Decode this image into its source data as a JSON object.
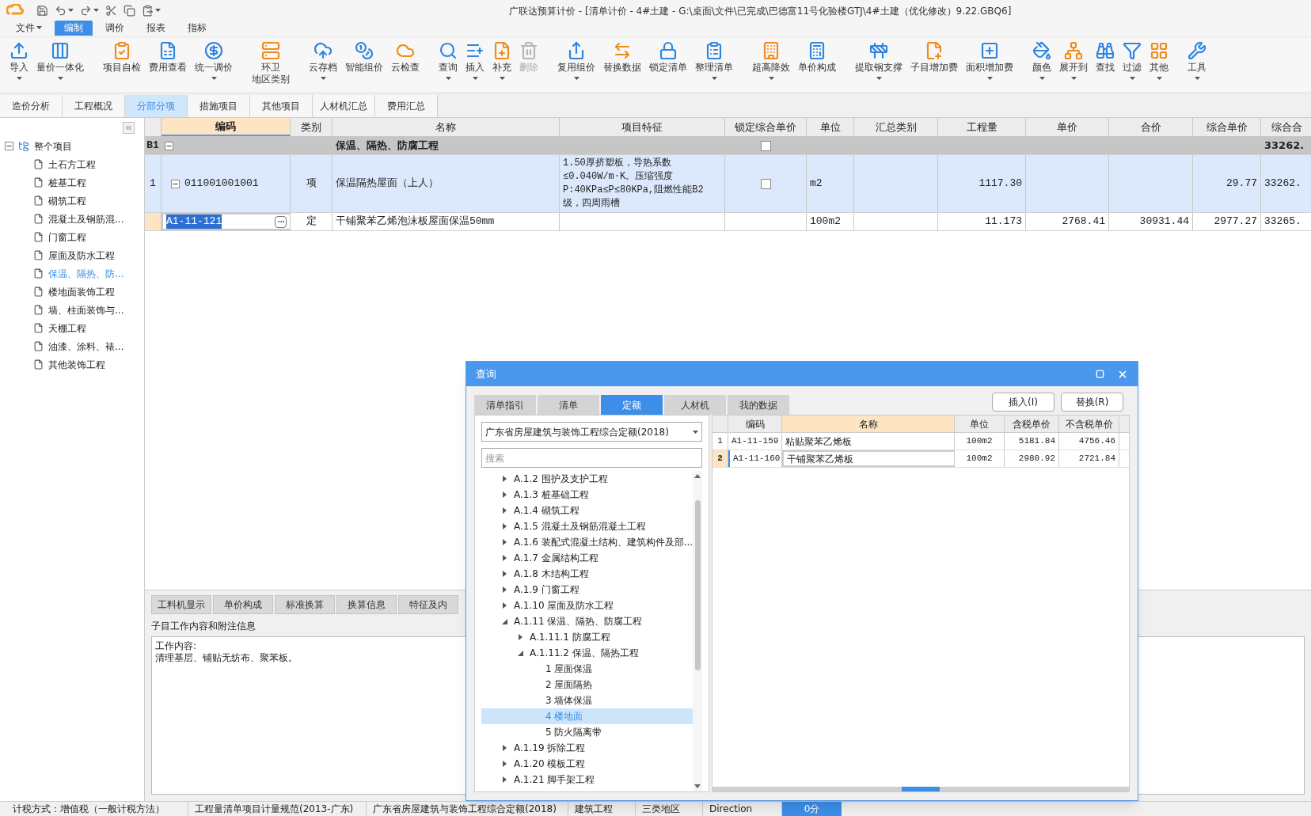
{
  "title_bar": {
    "title": "广联达预算计价 - [清单计价 - 4#土建 - G:\\桌面\\文件\\已完成\\巴德富11号化验楼GTJ\\4#土建（优化修改）9.22.GBQ6]"
  },
  "menu": [
    {
      "label": "文件",
      "dropdown": true,
      "selected": false
    },
    {
      "label": "编制",
      "dropdown": false,
      "selected": true
    },
    {
      "label": "调价",
      "dropdown": false,
      "selected": false
    },
    {
      "label": "报表",
      "dropdown": false,
      "selected": false
    },
    {
      "label": "指标",
      "dropdown": false,
      "selected": false
    }
  ],
  "ribbon": [
    [
      {
        "label": "导入",
        "dropdown": true,
        "disabled": false
      },
      {
        "label": "量价一体化",
        "dropdown": true,
        "disabled": false
      }
    ],
    [
      {
        "label": "项目自检",
        "dropdown": false,
        "disabled": false
      },
      {
        "label": "费用查看",
        "dropdown": false,
        "disabled": false
      },
      {
        "label": "统一调价",
        "dropdown": true,
        "disabled": false
      }
    ],
    [
      {
        "lines": [
          "环卫",
          "地区类别"
        ],
        "dropdown": false,
        "disabled": false
      }
    ],
    [
      {
        "label": "云存档",
        "dropdown": true,
        "disabled": false
      },
      {
        "label": "智能组价",
        "dropdown": false,
        "disabled": false
      },
      {
        "label": "云检查",
        "dropdown": false,
        "disabled": false
      }
    ],
    [
      {
        "label": "查询",
        "dropdown": true,
        "disabled": false
      },
      {
        "label": "插入",
        "dropdown": true,
        "disabled": false
      },
      {
        "label": "补充",
        "dropdown": true,
        "disabled": false
      },
      {
        "label": "删除",
        "dropdown": false,
        "disabled": true
      }
    ],
    [
      {
        "label": "复用组价",
        "dropdown": true,
        "disabled": false
      },
      {
        "label": "替换数据",
        "dropdown": false,
        "disabled": false
      },
      {
        "label": "锁定清单",
        "dropdown": false,
        "disabled": false
      },
      {
        "label": "整理清单",
        "dropdown": true,
        "disabled": false
      }
    ],
    [
      {
        "label": "超高降效",
        "dropdown": true,
        "disabled": false
      },
      {
        "label": "单价构成",
        "dropdown": false,
        "disabled": false
      }
    ],
    [
      {
        "label": "提取钢支撑",
        "dropdown": true,
        "disabled": false
      },
      {
        "label": "子目增加费",
        "dropdown": false,
        "disabled": false
      },
      {
        "label": "面积增加费",
        "dropdown": true,
        "disabled": false
      }
    ],
    [
      {
        "label": "颜色",
        "dropdown": true,
        "disabled": false
      },
      {
        "label": "展开到",
        "dropdown": true,
        "disabled": false
      },
      {
        "label": "查找",
        "dropdown": false,
        "disabled": false
      },
      {
        "label": "过滤",
        "dropdown": true,
        "disabled": false
      },
      {
        "label": "其他",
        "dropdown": true,
        "disabled": false
      }
    ],
    [
      {
        "label": "工具",
        "dropdown": true,
        "disabled": false
      }
    ]
  ],
  "view_tabs": [
    {
      "label": "造价分析",
      "selected": false
    },
    {
      "label": "工程概况",
      "selected": false
    },
    {
      "label": "分部分项",
      "selected": true
    },
    {
      "label": "措施项目",
      "selected": false
    },
    {
      "label": "其他项目",
      "selected": false
    },
    {
      "label": "人材机汇总",
      "selected": false
    },
    {
      "label": "费用汇总",
      "selected": false
    }
  ],
  "project_tree": {
    "label": "整个项目",
    "expanded": true,
    "selected": false,
    "children": [
      {
        "label": "土石方工程",
        "selected": false
      },
      {
        "label": "桩基工程",
        "selected": false
      },
      {
        "label": "砌筑工程",
        "selected": false
      },
      {
        "label": "混凝土及钢筋混...",
        "selected": false
      },
      {
        "label": "门窗工程",
        "selected": false
      },
      {
        "label": "屋面及防水工程",
        "selected": false
      },
      {
        "label": "保温、隔热、防...",
        "selected": true
      },
      {
        "label": "楼地面装饰工程",
        "selected": false
      },
      {
        "label": "墙、柱面装饰与...",
        "selected": false
      },
      {
        "label": "天棚工程",
        "selected": false
      },
      {
        "label": "油漆、涂料、裱...",
        "selected": false
      },
      {
        "label": "其他装饰工程",
        "selected": false
      }
    ]
  },
  "table": {
    "columns": [
      {
        "label": "编码",
        "current": true
      },
      {
        "label": "类别",
        "current": false
      },
      {
        "label": "名称",
        "current": false
      },
      {
        "label": "项目特征",
        "current": false
      },
      {
        "label": "锁定综合单价",
        "current": false
      },
      {
        "label": "单位",
        "current": false
      },
      {
        "label": "汇总类别",
        "current": false
      },
      {
        "label": "工程量",
        "current": false
      },
      {
        "label": "单价",
        "current": false
      },
      {
        "label": "合价",
        "current": false
      },
      {
        "label": "综合单价",
        "current": false
      },
      {
        "label": "综合合",
        "current": false
      }
    ],
    "rows": [
      {
        "kind": "section",
        "no": "B1",
        "expanded": true,
        "selected": false,
        "code": "",
        "type": "",
        "name": "保温、隔热、防腐工程",
        "features": "",
        "locked": false,
        "unit": "",
        "summary": "",
        "qty": "",
        "price": "",
        "total": "",
        "unit_total": "",
        "sum": "33262."
      },
      {
        "kind": "item",
        "no": "1",
        "expanded": true,
        "selected": false,
        "code": "011001001001",
        "type": "项",
        "name": "保温隔热屋面（上人）",
        "features": "1.50厚挤塑板，导热系数≤0.040W/m·K。压缩强度P:40KPa≤P≤80KPa,阻燃性能B2级，四周雨槽",
        "locked": false,
        "unit": "m2",
        "summary": "",
        "qty": "1117.30",
        "price": "",
        "total": "",
        "unit_total": "29.77",
        "sum": "33262."
      },
      {
        "kind": "quota",
        "no": "",
        "selected": true,
        "code": "A1-11-121",
        "type": "定",
        "name": "干铺聚苯乙烯泡沫板屋面保温50mm",
        "features": "",
        "unit": "100m2",
        "summary": "",
        "qty": "11.173",
        "price": "2768.41",
        "total": "30931.44",
        "unit_total": "2977.27",
        "sum": "33265."
      }
    ]
  },
  "detail_panel": {
    "tabs": [
      "工料机显示",
      "单价构成",
      "标准换算",
      "换算信息",
      "特征及内"
    ],
    "heading": "子目工作内容和附注信息",
    "text": "工作内容:\n清理基层、铺贴无纺布、聚苯板。"
  },
  "status_bar": [
    {
      "kind": "text",
      "label": "计税方式：增值税（一般计税方法）"
    },
    {
      "kind": "text",
      "label": "工程量清单项目计量规范(2013-广东)"
    },
    {
      "kind": "text",
      "label": "广东省房屋建筑与装饰工程综合定额(2018)"
    },
    {
      "kind": "text",
      "label": "建筑工程"
    },
    {
      "kind": "text",
      "label": "三类地区"
    },
    {
      "kind": "text",
      "label": "Direction"
    },
    {
      "kind": "badge",
      "label": "0分"
    }
  ],
  "dialog": {
    "title": "查询",
    "tabs": [
      {
        "label": "清单指引",
        "selected": false
      },
      {
        "label": "清单",
        "selected": false
      },
      {
        "label": "定额",
        "selected": true
      },
      {
        "label": "人材机",
        "selected": false
      },
      {
        "label": "我的数据",
        "selected": false
      }
    ],
    "buttons": [
      "插入(I)",
      "替换(R)"
    ],
    "library": {
      "value": "广东省房屋建筑与装饰工程综合定额(2018)"
    },
    "search": {
      "placeholder": "搜索"
    },
    "tree": [
      {
        "label": "A.1.2 围护及支护工程",
        "expanded": false,
        "selected": false
      },
      {
        "label": "A.1.3 桩基础工程",
        "expanded": false,
        "selected": false
      },
      {
        "label": "A.1.4 砌筑工程",
        "expanded": false,
        "selected": false
      },
      {
        "label": "A.1.5 混凝土及钢筋混凝土工程",
        "expanded": false,
        "selected": false
      },
      {
        "label": "A.1.6 装配式混凝土结构、建筑构件及部...",
        "expanded": false,
        "selected": false
      },
      {
        "label": "A.1.7 金属结构工程",
        "expanded": false,
        "selected": false
      },
      {
        "label": "A.1.8 木结构工程",
        "expanded": false,
        "selected": false
      },
      {
        "label": "A.1.9 门窗工程",
        "expanded": false,
        "selected": false
      },
      {
        "label": "A.1.10 屋面及防水工程",
        "expanded": false,
        "selected": false
      },
      {
        "label": "A.1.11 保温、隔热、防腐工程",
        "expanded": true,
        "selected": false,
        "children": [
          {
            "label": "A.1.11.1 防腐工程",
            "expanded": false,
            "selected": false
          },
          {
            "label": "A.1.11.2 保温、隔热工程",
            "expanded": true,
            "selected": false,
            "children": [
              {
                "label": "1 屋面保温",
                "selected": false
              },
              {
                "label": "2 屋面隔热",
                "selected": false
              },
              {
                "label": "3 墙体保温",
                "selected": false
              },
              {
                "label": "4 楼地面",
                "selected": true
              },
              {
                "label": "5 防火隔离带",
                "selected": false
              }
            ]
          }
        ]
      },
      {
        "label": "A.1.19 拆除工程",
        "expanded": false,
        "selected": false
      },
      {
        "label": "A.1.20 模板工程",
        "expanded": false,
        "selected": false
      },
      {
        "label": "A.1.21 脚手架工程",
        "expanded": false,
        "selected": false
      }
    ],
    "grid": {
      "columns": [
        {
          "label": "编码",
          "current": false
        },
        {
          "label": "名称",
          "current": true
        },
        {
          "label": "单位",
          "current": false
        },
        {
          "label": "含税单价",
          "current": false
        },
        {
          "label": "不含税单价",
          "current": false
        }
      ],
      "rows": [
        {
          "no": "1",
          "selected": false,
          "cells": [
            "A1-11-159",
            "粘贴聚苯乙烯板",
            "100m2",
            "5181.84",
            "4756.46"
          ]
        },
        {
          "no": "2",
          "selected": true,
          "cells": [
            "A1-11-160",
            "干铺聚苯乙烯板",
            "100m2",
            "2980.92",
            "2721.84"
          ]
        }
      ]
    }
  }
}
